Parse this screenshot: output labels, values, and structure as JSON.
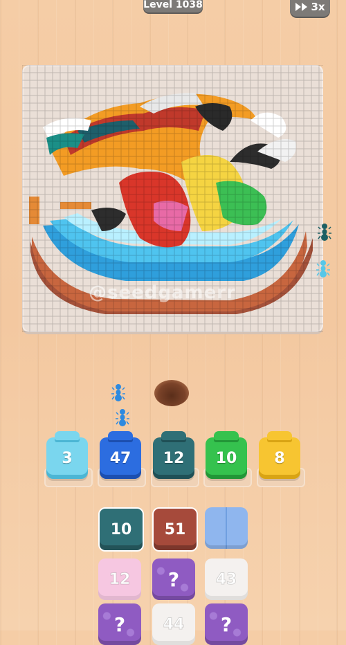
{
  "header": {
    "level_label": "Level 1038",
    "speed_label": "3x",
    "speed_icon": "fast-forward-icon"
  },
  "board": {
    "watermark": "@seedgamerr"
  },
  "spools": [
    {
      "count": "3",
      "color": "#7ad6ee",
      "dark": "#4cb6d4"
    },
    {
      "count": "47",
      "color": "#2c6de0",
      "dark": "#1c4fb0"
    },
    {
      "count": "12",
      "color": "#2f6f76",
      "dark": "#1f5056"
    },
    {
      "count": "10",
      "color": "#35c24e",
      "dark": "#229637"
    },
    {
      "count": "8",
      "color": "#f7c531",
      "dark": "#d9a414"
    }
  ],
  "crates": [
    {
      "label": "10",
      "state": "ready",
      "color": "#2f6f76"
    },
    {
      "label": "51",
      "state": "ready",
      "color": "#a64a3b"
    },
    {
      "label": "",
      "state": "empty",
      "color": "#8fb6ee"
    },
    {
      "label": "12",
      "state": "locked",
      "color": "#f6c7e1"
    },
    {
      "label": "?",
      "state": "mystery",
      "color": "#8f5bc2"
    },
    {
      "label": "43",
      "state": "locked",
      "color": "#f4f1ef"
    },
    {
      "label": "?",
      "state": "mystery",
      "color": "#8f5bc2"
    },
    {
      "label": "44",
      "state": "locked",
      "color": "#f4f1ef"
    },
    {
      "label": "?",
      "state": "mystery",
      "color": "#8f5bc2"
    }
  ]
}
